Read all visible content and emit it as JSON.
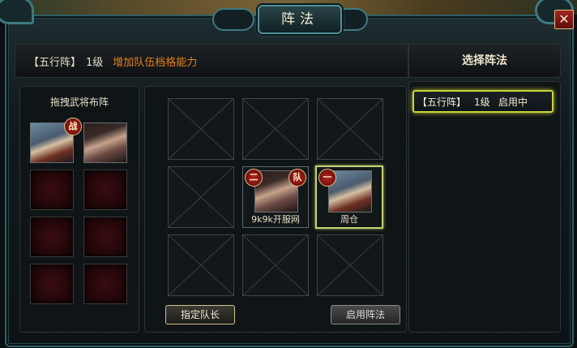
{
  "window": {
    "title": "阵法",
    "close_label": "✕"
  },
  "header": {
    "formation_name": "【五行阵】",
    "level": "1级",
    "description": "增加队伍档格能力"
  },
  "right_panel": {
    "title": "选择阵法",
    "items": [
      {
        "name": "【五行阵】",
        "level": "1级",
        "status": "启用中"
      }
    ]
  },
  "left_panel": {
    "title": "拖拽武将布阵",
    "roster": [
      {
        "portrait": "bearded-man-white-hat",
        "badge": "战"
      },
      {
        "portrait": "dark-hair-woman",
        "badge": ""
      }
    ]
  },
  "grid": {
    "cells": [
      {
        "state": "empty"
      },
      {
        "state": "empty"
      },
      {
        "state": "empty"
      },
      {
        "state": "empty"
      },
      {
        "state": "occupied",
        "portrait": "dark-hair-woman",
        "badge_left": "二",
        "badge_right": "队",
        "label": "9k9k开服网"
      },
      {
        "state": "occupied",
        "portrait": "bearded-man-white-hat",
        "badge_left": "一",
        "label": "周仓",
        "highlight": true
      },
      {
        "state": "empty"
      },
      {
        "state": "empty"
      },
      {
        "state": "empty"
      }
    ]
  },
  "buttons": {
    "assign_captain": "指定队长",
    "enable_formation": "启用阵法"
  },
  "colors": {
    "accent_orange": "#e57f1f",
    "selection_yellow": "#c9d43c",
    "badge_red": "#b3241d"
  }
}
